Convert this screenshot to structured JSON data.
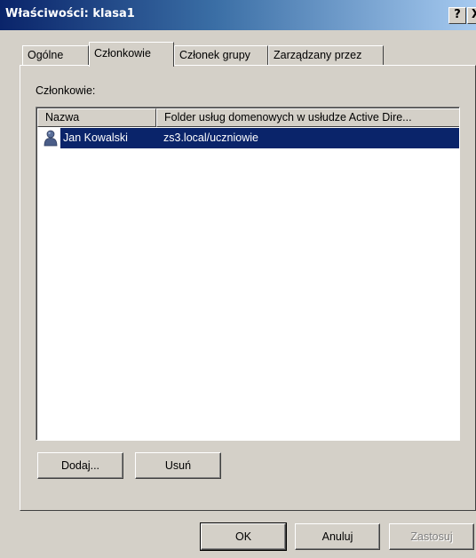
{
  "window": {
    "title": "Właściwości: klasa1",
    "help_label": "?",
    "close_label": "X"
  },
  "tabs": [
    {
      "label": "Ogólne",
      "active": false
    },
    {
      "label": "Członkowie",
      "active": true
    },
    {
      "label": "Członek grupy",
      "active": false
    },
    {
      "label": "Zarządzany przez",
      "active": false
    }
  ],
  "members": {
    "caption": "Członkowie:",
    "columns": [
      "Nazwa",
      "Folder usług domenowych w usłudze Active Dire..."
    ],
    "rows": [
      {
        "icon": "user-icon",
        "name": "Jan Kowalski",
        "folder": "zs3.local/uczniowie",
        "selected": true
      }
    ]
  },
  "buttons": {
    "add": "Dodaj...",
    "remove": "Usuń",
    "ok": "OK",
    "cancel": "Anuluj",
    "apply": "Zastosuj"
  },
  "colors": {
    "selection": "#0a246a",
    "dialog_face": "#d4d0c8",
    "titlebar_start": "#0a246a",
    "titlebar_end": "#a6caf0"
  }
}
